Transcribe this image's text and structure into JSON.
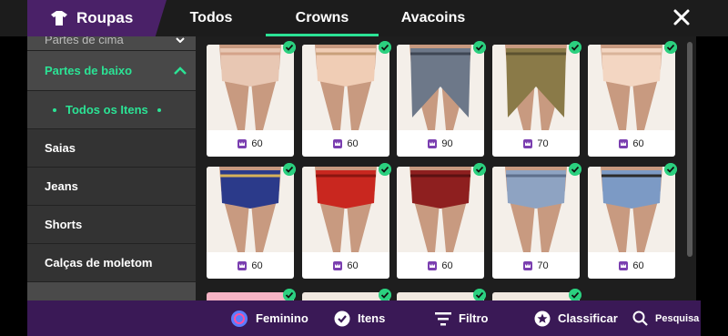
{
  "header": {
    "brand_title": "Roupas",
    "brand_icon": "shirt-icon",
    "tabs": [
      {
        "label": "Todos",
        "active": false
      },
      {
        "label": "Crowns",
        "active": true
      },
      {
        "label": "Avacoins",
        "active": false
      }
    ],
    "close_icon": "close-icon"
  },
  "sidebar": {
    "top_cut_label": "Partes de cima",
    "parent_label": "Partes de baixo",
    "sub_label": "Todos os Itens",
    "items": [
      "Saias",
      "Jeans",
      "Shorts",
      "Calças de moletom"
    ]
  },
  "grid": {
    "items": [
      {
        "price": "60",
        "owned": true
      },
      {
        "price": "60",
        "owned": true
      },
      {
        "price": "90",
        "owned": true
      },
      {
        "price": "70",
        "owned": true
      },
      {
        "price": "60",
        "owned": true
      },
      {
        "price": "60",
        "owned": true
      },
      {
        "price": "60",
        "owned": true
      },
      {
        "price": "60",
        "owned": true
      },
      {
        "price": "70",
        "owned": true
      },
      {
        "price": "60",
        "owned": true
      }
    ]
  },
  "bottombar": {
    "gender_label": "Feminino",
    "items_label": "Itens",
    "filter_label": "Filtro",
    "sort_label": "Classificar",
    "search_label": "Pesquisa"
  },
  "colors": {
    "accent": "#2be395",
    "brand": "#4a2168",
    "bottom": "#3a1956",
    "crown": "#7b3fb0"
  }
}
